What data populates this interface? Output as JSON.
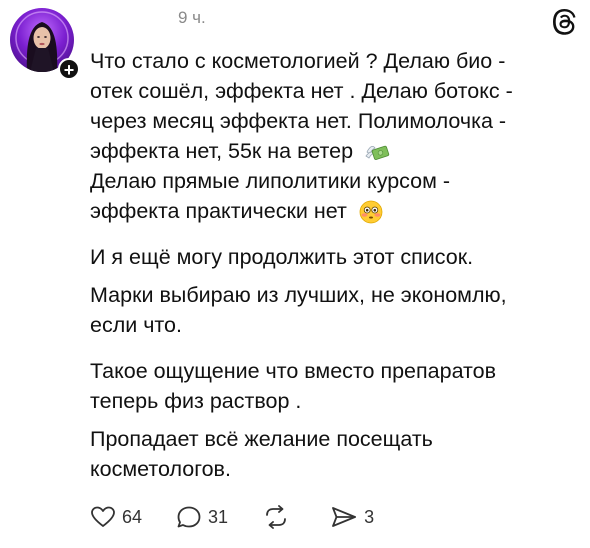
{
  "header": {
    "timestamp": "9 ч.",
    "logo_icon": "threads-logo-icon",
    "follow_icon": "plus-icon"
  },
  "post": {
    "paragraphs": [
      {
        "lines": [
          "Что стало с косметологией ? Делаю био -",
          "отек сошёл, эффекта нет . Делаю ботокс -",
          "через месяц эффекта нет. Полимолочка -",
          "эффекта нет, 55к на ветер"
        ],
        "emoji": "money-with-wings-emoji"
      },
      {
        "lines": [
          "Делаю прямые липолитики курсом -",
          "эффекта практически нет"
        ],
        "emoji": "flushed-face-emoji"
      },
      {
        "lines": [
          "И я ещё могу продолжить этот список."
        ]
      },
      {
        "lines": [
          "Марки выбираю из лучших, не экономлю,",
          "если что."
        ]
      },
      {
        "lines": [
          "Такое ощущение что вместо препаратов",
          "теперь физ раствор ."
        ]
      },
      {
        "lines": [
          "Пропадает всё желание посещать",
          "косметологов."
        ]
      }
    ]
  },
  "actions": {
    "like_count": "64",
    "reply_count": "31",
    "repost_count": "",
    "share_count": "3",
    "like_icon": "heart-icon",
    "reply_icon": "comment-icon",
    "repost_icon": "repost-icon",
    "share_icon": "send-icon"
  },
  "colors": {
    "text": "#111111",
    "muted": "#8a8a8a",
    "avatar_accent": "#7b1fd0"
  }
}
